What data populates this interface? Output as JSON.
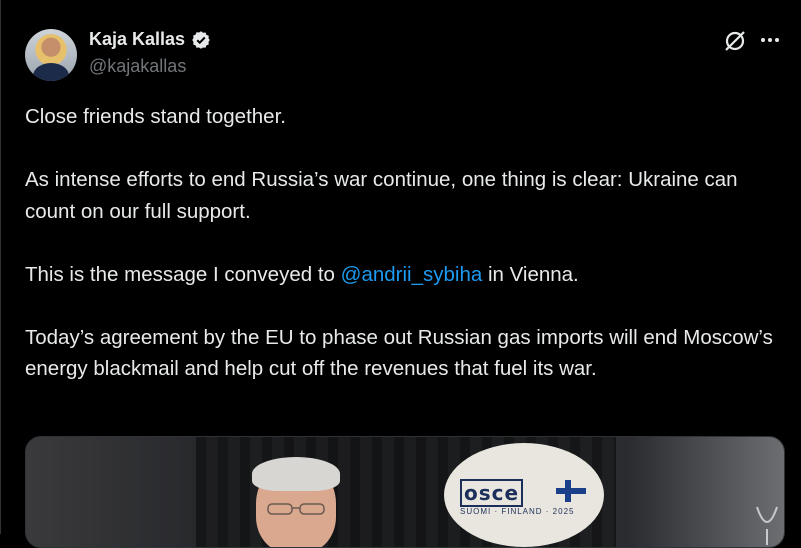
{
  "author": {
    "name": "Kaja Kallas",
    "handle": "@kajakallas",
    "verified_icon": "verified-badge-icon"
  },
  "actions": {
    "grok_icon": "grok-icon",
    "more_icon": "more-options-icon"
  },
  "tweet": {
    "p1": "Close friends stand together.",
    "p2": "As intense efforts to end Russia’s war continue, one thing is clear: Ukraine can count on our full support.",
    "p3_before": "This is the message I conveyed to ",
    "p3_mention": "@andrii_sybiha",
    "p3_after": " in Vienna.",
    "p4": "Today’s agreement by the EU to phase out Russian gas imports will end Moscow’s energy blackmail and help cut off the revenues that fuel its war."
  },
  "media": {
    "logo_text": "osce",
    "logo_sub": "SUOMI · FINLAND · 2025"
  },
  "colors": {
    "background": "#000000",
    "text": "#e7e9ea",
    "secondary": "#71767b",
    "link": "#1d9bf0"
  }
}
